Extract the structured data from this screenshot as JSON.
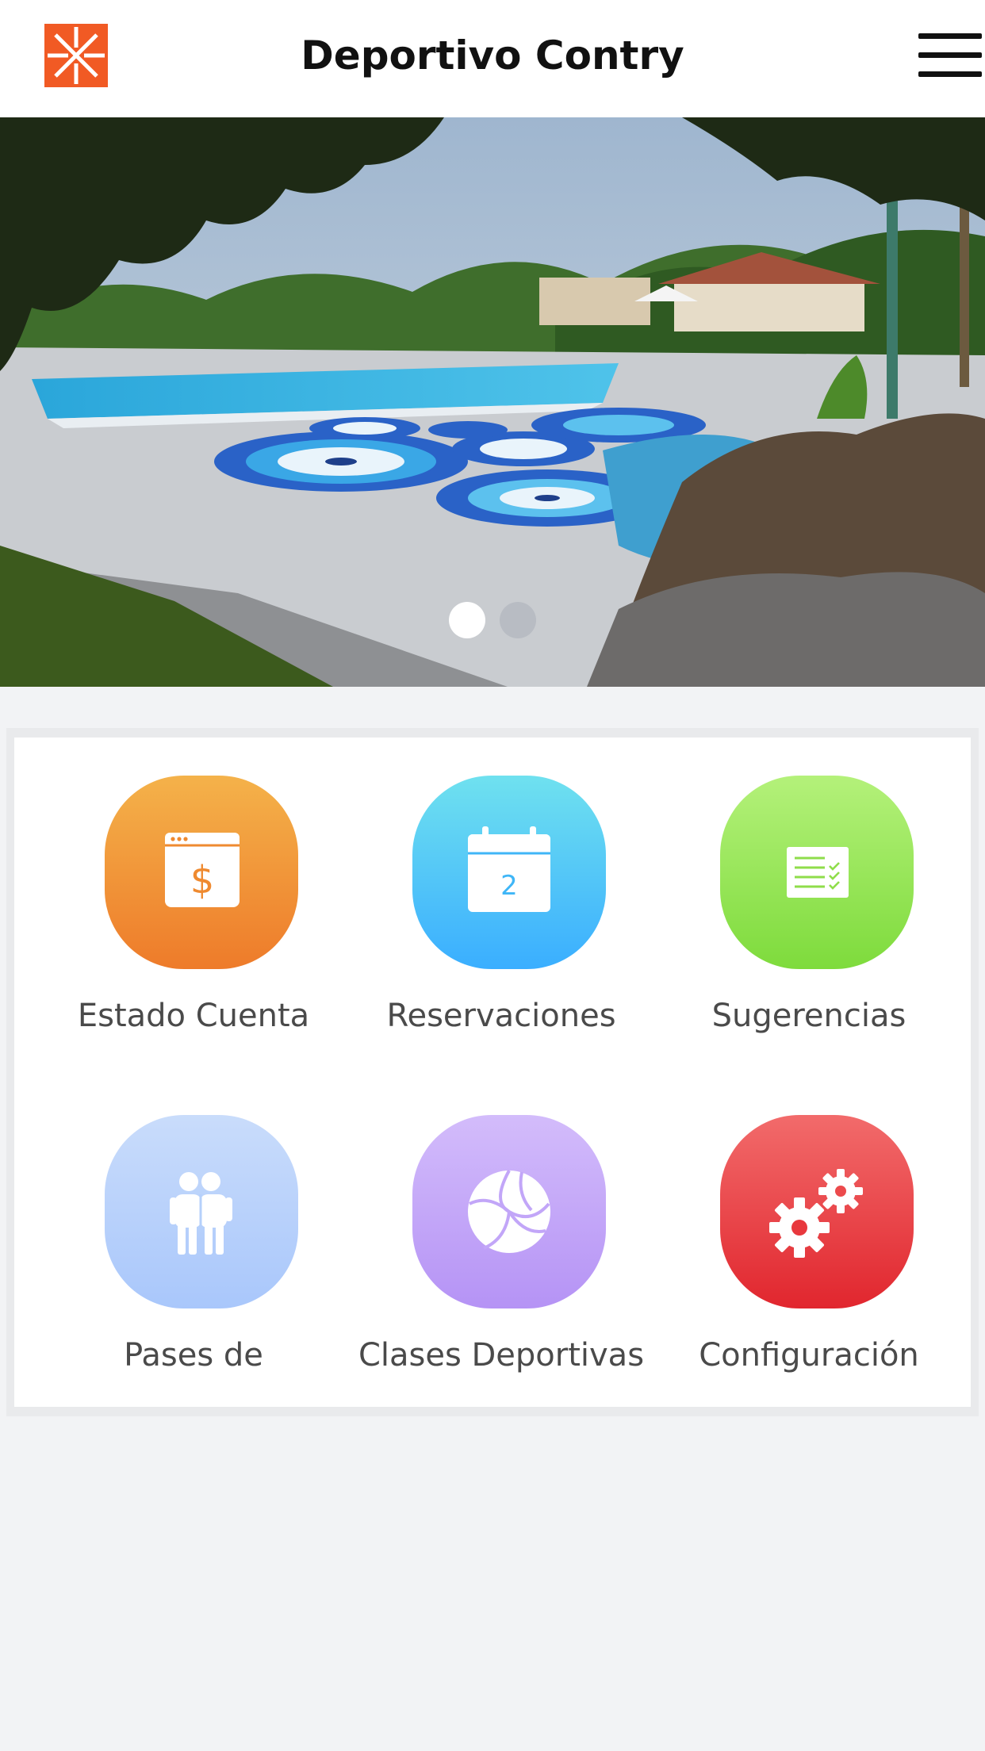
{
  "header": {
    "title": "Deportivo Contry",
    "logo_icon": "club-logo-icon",
    "menu_icon": "hamburger-menu-icon",
    "logo_color": "#f15a24"
  },
  "carousel": {
    "slide_count": 2,
    "active_index": 0,
    "image_description": "pool-photo",
    "colors": {
      "active_dot": "#ffffff",
      "inactive_dot": "#b8bcc3"
    }
  },
  "menu_grid": {
    "items": [
      {
        "label": "Estado Cuenta",
        "icon": "account-statement-icon",
        "gradient": [
          "#f4b24a",
          "#ee7b2a"
        ]
      },
      {
        "label": "Reservaciones",
        "icon": "calendar-icon",
        "gradient": [
          "#6fe1ef",
          "#3aaeff"
        ],
        "calendar_day": "2"
      },
      {
        "label": "Sugerencias",
        "icon": "checklist-icon",
        "gradient": [
          "#b4f17a",
          "#7edb3c"
        ]
      },
      {
        "label": "Pases de",
        "icon": "friends-icon",
        "gradient": [
          "#c9dcfb",
          "#a9c7fb"
        ]
      },
      {
        "label": "Clases Deportivas",
        "icon": "volleyball-icon",
        "gradient": [
          "#d3bcfb",
          "#b593f5"
        ]
      },
      {
        "label": "Configuración",
        "icon": "gears-icon",
        "gradient": [
          "#f26b6b",
          "#e1262e"
        ]
      }
    ]
  }
}
